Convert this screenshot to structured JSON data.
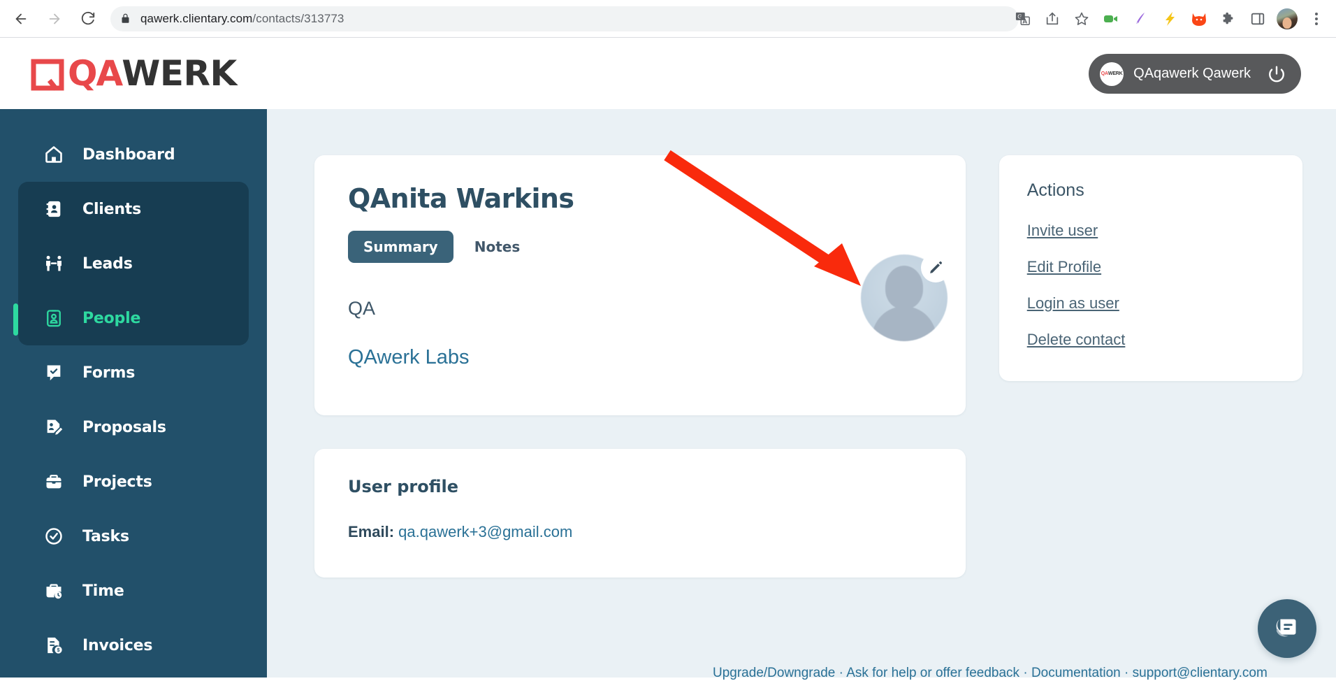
{
  "browser": {
    "back_icon": "back-arrow-icon",
    "forward_icon": "forward-arrow-icon",
    "reload_icon": "reload-icon",
    "lock_icon": "lock-icon",
    "url_domain": "qawerk.clientary.com",
    "url_path": "/contacts/313773",
    "toolbar_icons": [
      "translate-icon",
      "share-icon",
      "bookmark-star-icon",
      "video-camera-extension-icon",
      "pen-extension-icon",
      "lightning-extension-icon",
      "fox-extension-icon",
      "puzzle-extensions-icon",
      "side-panel-icon",
      "profile-avatar",
      "chrome-menu-icon"
    ]
  },
  "header": {
    "logo_qa": "QA",
    "logo_werk": "WERK",
    "user_name": "QAqawerk Qawerk",
    "avatar_qa": "QA",
    "avatar_werk": "WERK",
    "logout_icon": "power-icon"
  },
  "sidebar": {
    "items": [
      {
        "label": "Dashboard",
        "icon": "home-icon",
        "active": false,
        "in_group": false
      },
      {
        "label": "Clients",
        "icon": "address-book-icon",
        "active": false,
        "in_group": true
      },
      {
        "label": "Leads",
        "icon": "people-handshake-icon",
        "active": false,
        "in_group": true
      },
      {
        "label": "People",
        "icon": "contact-card-icon",
        "active": true,
        "in_group": true
      },
      {
        "label": "Forms",
        "icon": "form-check-icon",
        "active": false,
        "in_group": false
      },
      {
        "label": "Proposals",
        "icon": "proposal-edit-icon",
        "active": false,
        "in_group": false
      },
      {
        "label": "Projects",
        "icon": "briefcase-icon",
        "active": false,
        "in_group": false
      },
      {
        "label": "Tasks",
        "icon": "check-circle-icon",
        "active": false,
        "in_group": false
      },
      {
        "label": "Time",
        "icon": "time-clock-icon",
        "active": false,
        "in_group": false
      },
      {
        "label": "Invoices",
        "icon": "invoice-dollar-icon",
        "active": false,
        "in_group": false
      }
    ]
  },
  "contact": {
    "name": "QAnita Warkins",
    "tabs": [
      {
        "label": "Summary",
        "active": true
      },
      {
        "label": "Notes",
        "active": false
      }
    ],
    "job_title": "QA",
    "organization": "QAwerk Labs",
    "avatar_alt": "default-user-avatar",
    "edit_icon": "pencil-edit-icon"
  },
  "user_profile": {
    "title": "User profile",
    "email_label": "Email:",
    "email_value": "qa.qawerk+3@gmail.com"
  },
  "actions": {
    "title": "Actions",
    "items": [
      "Invite user",
      "Edit Profile",
      "Login as user",
      "Delete contact"
    ]
  },
  "footer": {
    "links": [
      "Upgrade/Downgrade",
      "Ask for help or offer feedback",
      "Documentation",
      "support@clientary.com"
    ],
    "separator": " · "
  },
  "chat": {
    "icon": "chat-bubble-icon"
  },
  "annotation": {
    "arrow_color": "#f92a0c",
    "points_to": "avatar-edit-region"
  },
  "colors": {
    "sidebar_bg": "#22506a",
    "sidebar_group_bg": "#173d52",
    "accent_green": "#2ed9a0",
    "main_bg": "#eaf1f5",
    "brand_red": "#e8484a",
    "link_blue": "#2a7196",
    "tab_active_bg": "#3a6379"
  }
}
